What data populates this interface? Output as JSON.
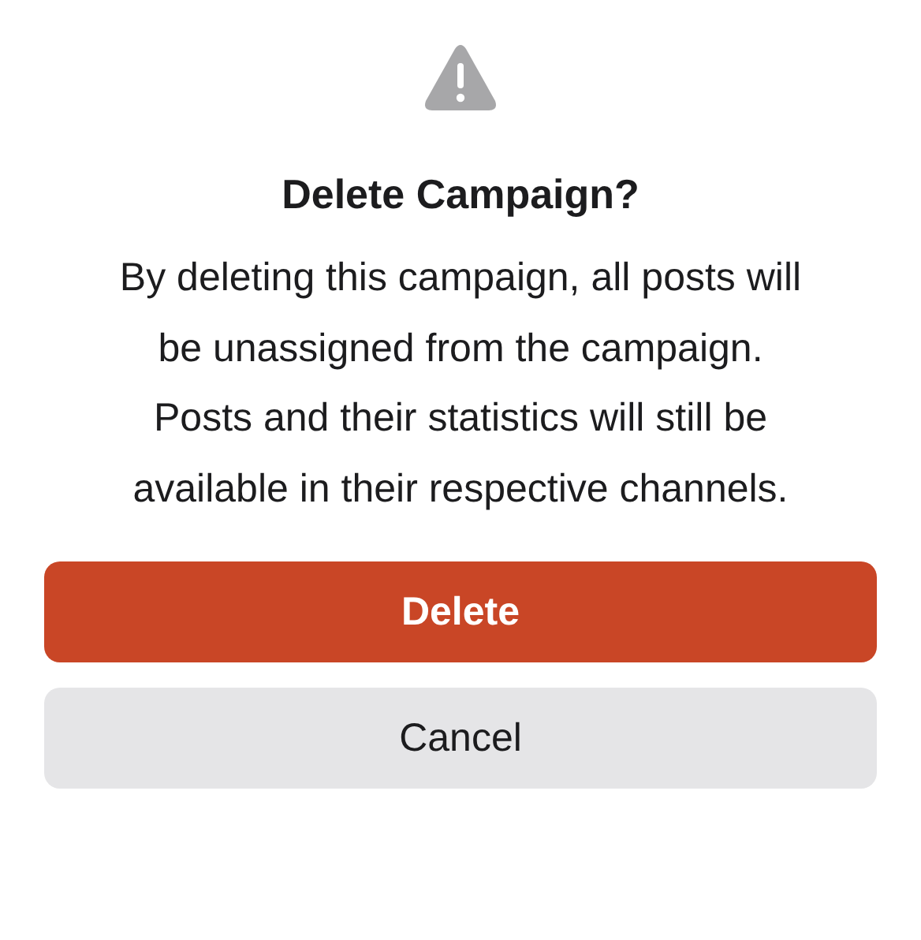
{
  "dialog": {
    "title": "Delete Campaign?",
    "message": "By deleting this campaign, all posts will be unassigned from the campaign. Posts and their statistics will still be available in their respective channels.",
    "buttons": [
      {
        "label": "Delete",
        "kind": "danger"
      },
      {
        "label": "Cancel",
        "kind": "secondary"
      }
    ]
  }
}
